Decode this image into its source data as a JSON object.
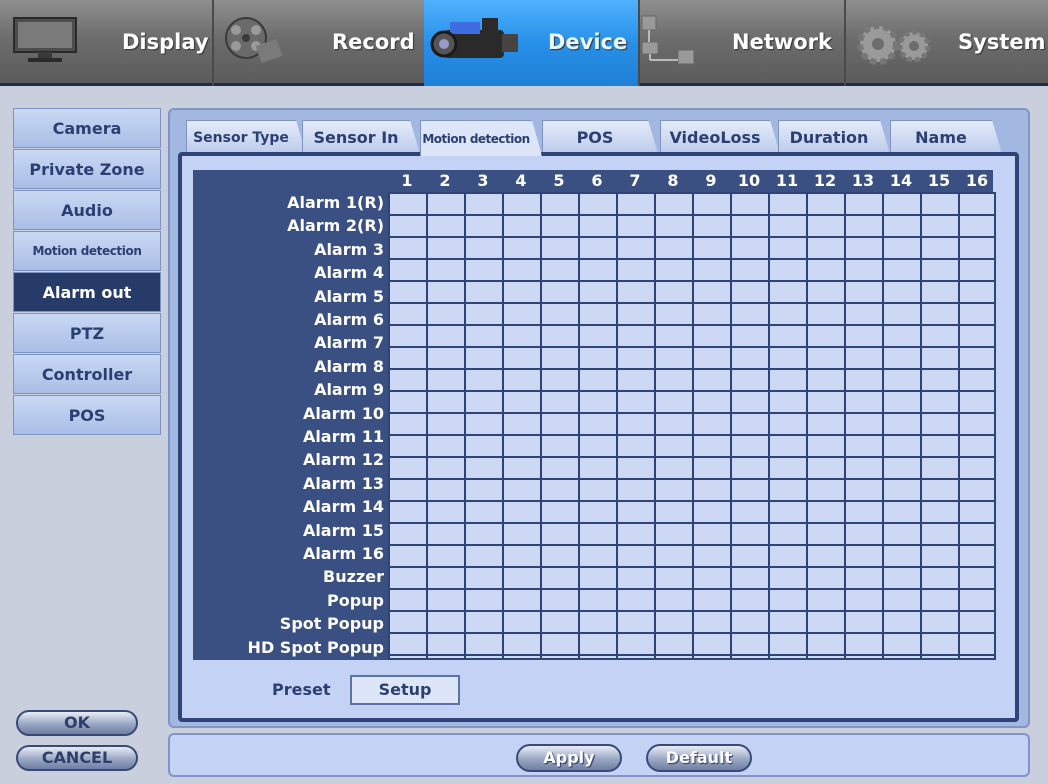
{
  "topnav": [
    {
      "label": "Display",
      "icon": "monitor-icon",
      "active": false
    },
    {
      "label": "Record",
      "icon": "film-reel-icon",
      "active": false
    },
    {
      "label": "Device",
      "icon": "camcorder-icon",
      "active": true
    },
    {
      "label": "Network",
      "icon": "network-icon",
      "active": false
    },
    {
      "label": "System",
      "icon": "gears-icon",
      "active": false
    }
  ],
  "sidebar": {
    "items": [
      {
        "label": "Camera"
      },
      {
        "label": "Private Zone"
      },
      {
        "label": "Audio"
      },
      {
        "label": "Motion detection"
      },
      {
        "label": "Alarm out",
        "active": true
      },
      {
        "label": "PTZ"
      },
      {
        "label": "Controller"
      },
      {
        "label": "POS"
      }
    ],
    "ok_label": "OK",
    "cancel_label": "CANCEL"
  },
  "tabs": [
    {
      "label": "Sensor Type"
    },
    {
      "label": "Sensor In"
    },
    {
      "label": "Motion detection",
      "active": true
    },
    {
      "label": "POS"
    },
    {
      "label": "VideoLoss"
    },
    {
      "label": "Duration"
    },
    {
      "label": "Name"
    }
  ],
  "grid": {
    "columns": [
      "1",
      "2",
      "3",
      "4",
      "5",
      "6",
      "7",
      "8",
      "9",
      "10",
      "11",
      "12",
      "13",
      "14",
      "15",
      "16"
    ],
    "rows": [
      "Alarm 1(R)",
      "Alarm 2(R)",
      "Alarm 3",
      "Alarm 4",
      "Alarm 5",
      "Alarm 6",
      "Alarm 7",
      "Alarm 8",
      "Alarm 9",
      "Alarm 10",
      "Alarm 11",
      "Alarm 12",
      "Alarm 13",
      "Alarm 14",
      "Alarm 15",
      "Alarm 16",
      "Buzzer",
      "Popup",
      "Spot Popup",
      "HD Spot Popup"
    ]
  },
  "preset": {
    "label": "Preset",
    "setup_label": "Setup"
  },
  "footer": {
    "apply_label": "Apply",
    "default_label": "Default"
  },
  "colors": {
    "active_nav": "#2790e8",
    "panel_dark": "#2e4478",
    "panel_light": "#c4d3f5"
  }
}
